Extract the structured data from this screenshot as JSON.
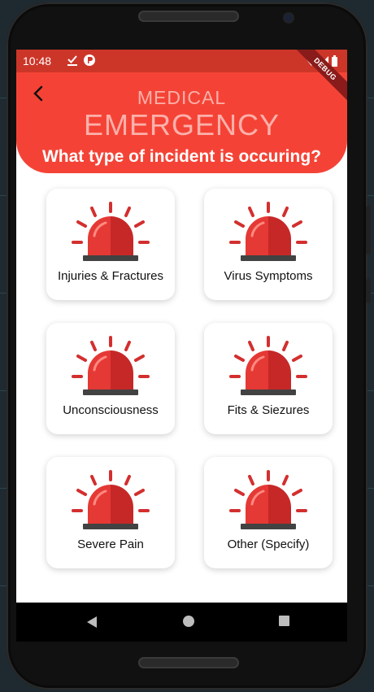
{
  "status_bar": {
    "time": "10:48",
    "icons": [
      "download-done-icon",
      "flutter-p-icon",
      "wifi-icon",
      "signal-icon",
      "battery-icon"
    ]
  },
  "debug_banner": "DEBUG",
  "header": {
    "back_icon": "arrow-back-icon",
    "subtitle": "MEDICAL",
    "title": "EMERGENCY",
    "question": "What type of incident is occuring?",
    "color": "#f44336"
  },
  "incidents": [
    {
      "label": "Injuries & Fractures",
      "icon": "siren-icon"
    },
    {
      "label": "Virus Symptoms",
      "icon": "siren-icon"
    },
    {
      "label": "Unconsciousness",
      "icon": "siren-icon"
    },
    {
      "label": "Fits & Siezures",
      "icon": "siren-icon"
    },
    {
      "label": "Severe Pain",
      "icon": "siren-icon"
    },
    {
      "label": "Other (Specify)",
      "icon": "siren-icon"
    }
  ],
  "nav_bar": {
    "icons": [
      "nav-back-icon",
      "nav-home-icon",
      "nav-recents-icon"
    ]
  }
}
